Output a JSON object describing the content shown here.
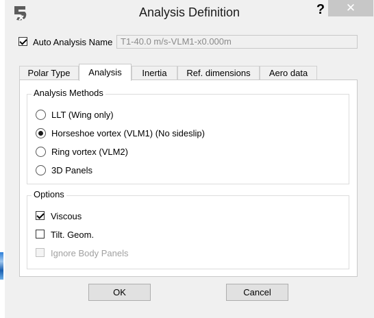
{
  "window": {
    "title": "Analysis Definition",
    "help_glyph": "?",
    "close_glyph": "✕",
    "app_icon": "xflr5-app-icon"
  },
  "auto_name": {
    "checked": true,
    "label": "Auto Analysis Name",
    "value": "T1-40.0 m/s-VLM1-x0.000m"
  },
  "tabs": [
    {
      "label": "Polar Type",
      "active": false
    },
    {
      "label": "Analysis",
      "active": true
    },
    {
      "label": "Inertia",
      "active": false
    },
    {
      "label": "Ref. dimensions",
      "active": false
    },
    {
      "label": "Aero data",
      "active": false
    }
  ],
  "analysis_methods": {
    "title": "Analysis Methods",
    "options": [
      {
        "label": "LLT (Wing only)",
        "selected": false
      },
      {
        "label": "Horseshoe vortex (VLM1) (No sideslip)",
        "selected": true
      },
      {
        "label": "Ring vortex (VLM2)",
        "selected": false
      },
      {
        "label": "3D Panels",
        "selected": false
      }
    ]
  },
  "options": {
    "title": "Options",
    "items": [
      {
        "label": "Viscous",
        "checked": true,
        "enabled": true
      },
      {
        "label": "Tilt. Geom.",
        "checked": false,
        "enabled": true
      },
      {
        "label": "Ignore Body Panels",
        "checked": false,
        "enabled": false
      }
    ]
  },
  "buttons": {
    "ok": "OK",
    "cancel": "Cancel"
  }
}
